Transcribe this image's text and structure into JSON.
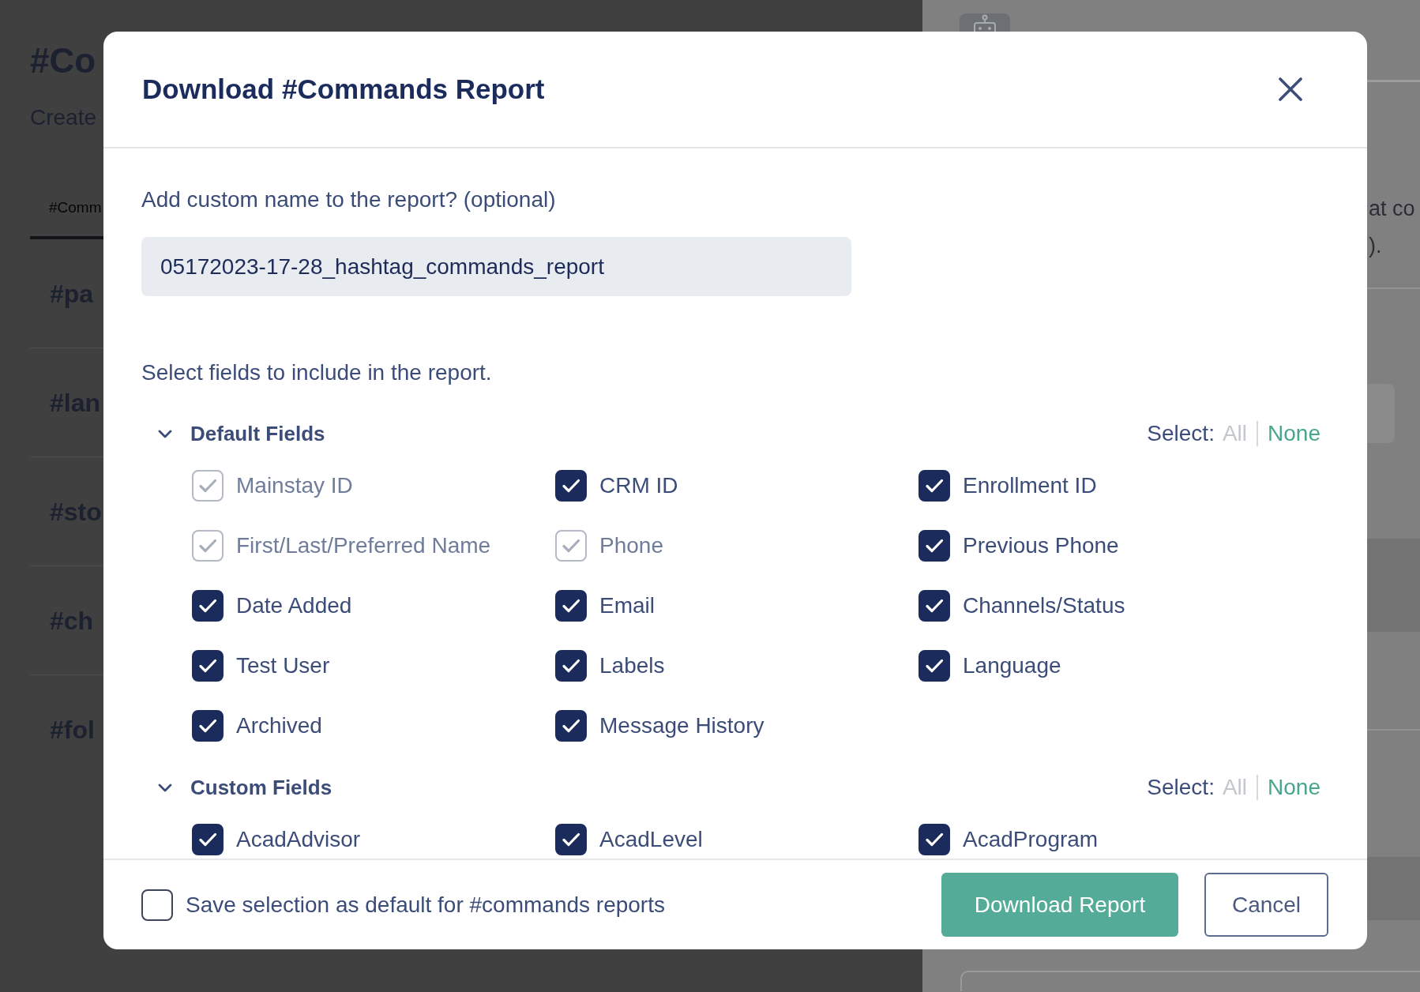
{
  "page": {
    "title": "#Co",
    "subtitle": "Create",
    "tabs": [
      {
        "label": "#Comm",
        "selected": true
      }
    ],
    "commands": [
      {
        "name": "#pa"
      },
      {
        "name": "#lan"
      },
      {
        "name": "#sto"
      },
      {
        "name": "#ch"
      },
      {
        "name": "#fol"
      }
    ]
  },
  "side_panel": {
    "description_lines": [
      "at co",
      ")."
    ]
  },
  "modal": {
    "title": "Download #Commands Report",
    "name_field": {
      "label": "Add custom name to the report? (optional)",
      "value": "05172023-17-28_hashtag_commands_report"
    },
    "fields_prompt": "Select fields to include in the report.",
    "sections": [
      {
        "title": "Default Fields",
        "expanded": true,
        "select_label": "Select:",
        "select_options": [
          {
            "label": "All",
            "disabled": true
          },
          {
            "label": "None",
            "disabled": false
          }
        ],
        "fields": [
          {
            "label": "Mainstay ID",
            "checked": true,
            "disabled": true
          },
          {
            "label": "CRM ID",
            "checked": true,
            "disabled": false
          },
          {
            "label": "Enrollment ID",
            "checked": true,
            "disabled": false
          },
          {
            "label": "First/Last/Preferred Name",
            "checked": true,
            "disabled": true
          },
          {
            "label": "Phone",
            "checked": true,
            "disabled": true
          },
          {
            "label": "Previous Phone",
            "checked": true,
            "disabled": false
          },
          {
            "label": "Date Added",
            "checked": true,
            "disabled": false
          },
          {
            "label": "Email",
            "checked": true,
            "disabled": false
          },
          {
            "label": "Channels/Status",
            "checked": true,
            "disabled": false
          },
          {
            "label": "Test User",
            "checked": true,
            "disabled": false
          },
          {
            "label": "Labels",
            "checked": true,
            "disabled": false
          },
          {
            "label": "Language",
            "checked": true,
            "disabled": false
          },
          {
            "label": "Archived",
            "checked": true,
            "disabled": false
          },
          {
            "label": "Message History",
            "checked": true,
            "disabled": false
          }
        ]
      },
      {
        "title": "Custom Fields",
        "expanded": true,
        "select_label": "Select:",
        "select_options": [
          {
            "label": "All",
            "disabled": true
          },
          {
            "label": "None",
            "disabled": false
          }
        ],
        "fields": [
          {
            "label": "AcadAdvisor",
            "checked": true,
            "disabled": false
          },
          {
            "label": "AcadLevel",
            "checked": true,
            "disabled": false
          },
          {
            "label": "AcadProgram",
            "checked": true,
            "disabled": false
          }
        ]
      }
    ],
    "save_default": {
      "label": "Save selection as default for #commands reports",
      "checked": false
    },
    "buttons": [
      {
        "label": "Download Report",
        "kind": "primary"
      },
      {
        "label": "Cancel",
        "kind": "secondary"
      }
    ]
  }
}
